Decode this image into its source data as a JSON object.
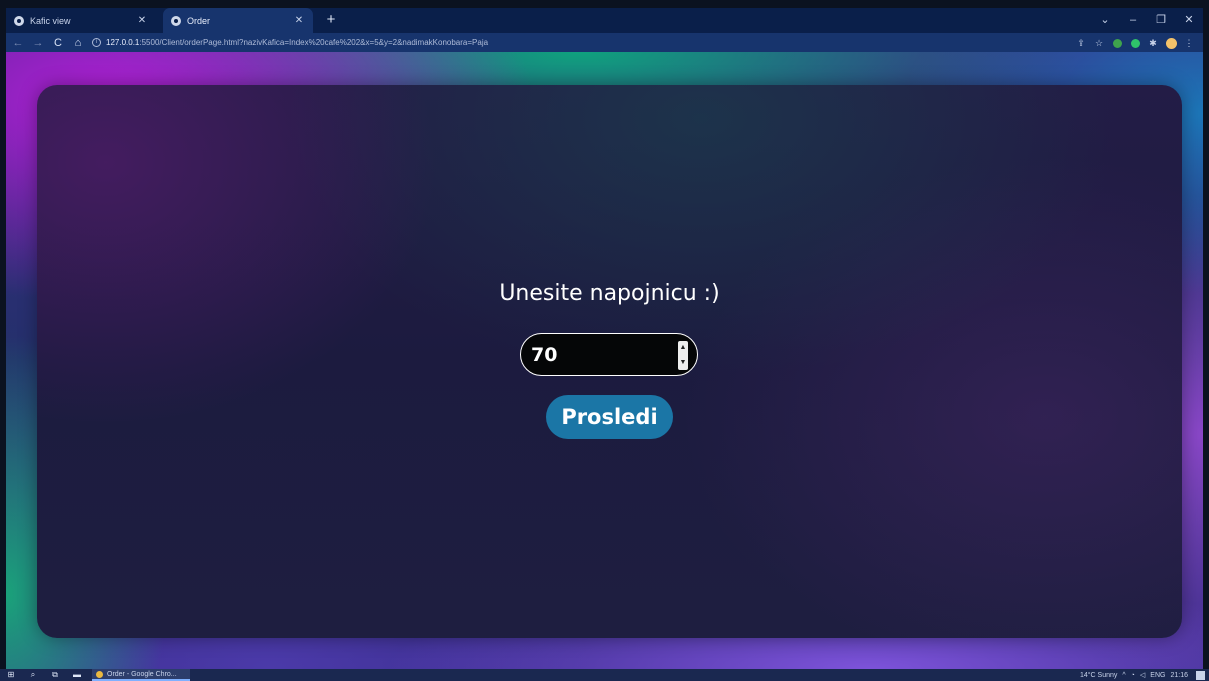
{
  "browser": {
    "tabs": [
      {
        "title": "Kafic view",
        "active": false
      },
      {
        "title": "Order",
        "active": true
      }
    ],
    "new_tab_label": "+",
    "window_controls": {
      "chevron": "⌄",
      "minimize": "–",
      "restore": "❐",
      "close": "✕"
    },
    "nav": {
      "back": "←",
      "forward": "→",
      "reload": "C",
      "home": "⌂"
    },
    "url_host": "127.0.0.1",
    "url_rest": ":5500/Client/orderPage.html?nazivKafica=Index%20cafe%202&x=5&y=2&nadimakKonobara=Paja",
    "toolbar_icons": [
      "share-icon",
      "star-icon",
      "extension-icon",
      "extension-icon",
      "puzzle-icon",
      "profile-icon",
      "menu-icon"
    ]
  },
  "page": {
    "prompt": "Unesite napojnicu :)",
    "tip_value": "70",
    "submit_label": "Prosledi",
    "accent_color": "#1b76a6"
  },
  "taskbar": {
    "app_label": "Order - Google Chro...",
    "weather": "14°C  Sunny",
    "language": "ENG",
    "time": "21:16"
  }
}
